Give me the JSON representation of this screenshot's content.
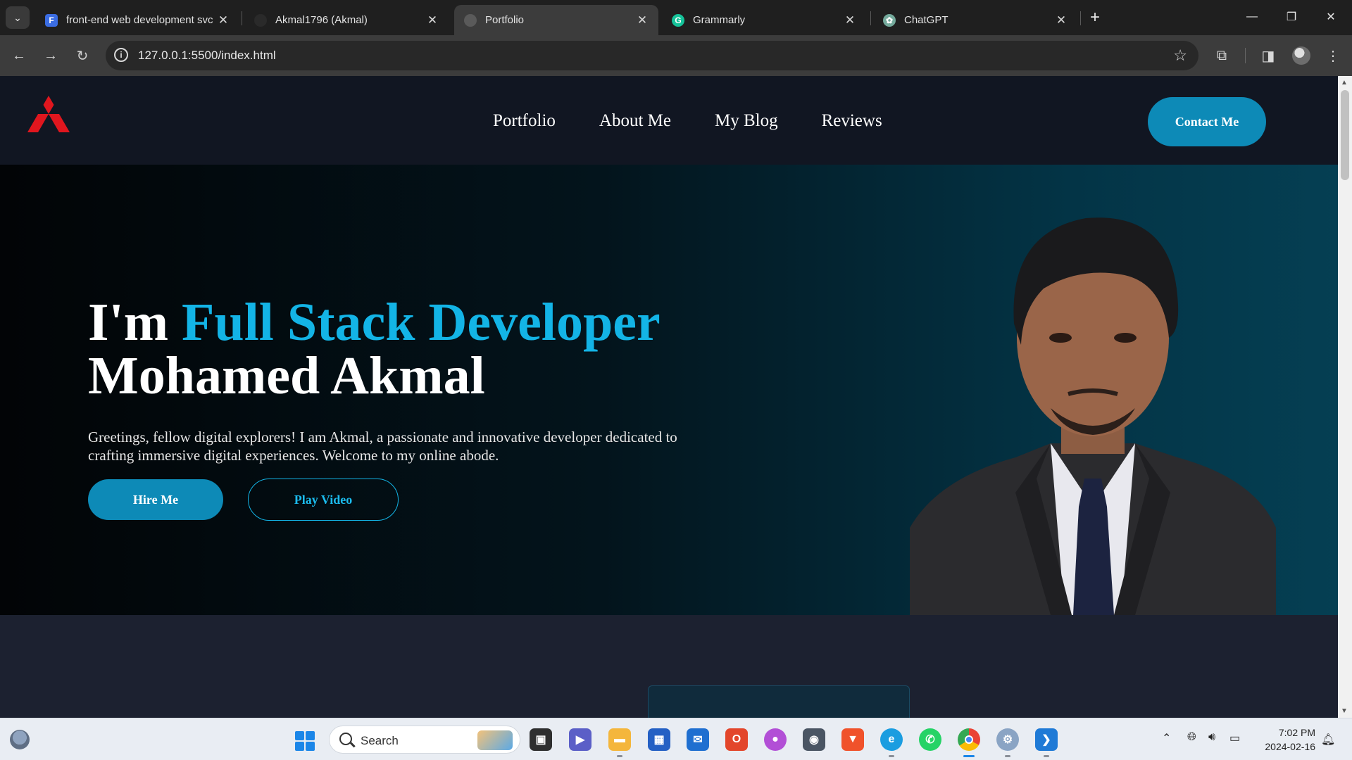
{
  "browser": {
    "tabs": [
      {
        "title": "front-end web development svc",
        "favicon": "forms-icon",
        "favicon_color": "#3b6de3",
        "active": false
      },
      {
        "title": "Akmal1796 (Akmal)",
        "favicon": "github-icon",
        "favicon_color": "#2a2a2a",
        "active": false
      },
      {
        "title": "Portfolio",
        "favicon": "globe-icon",
        "favicon_color": "#5a5a5a",
        "active": true
      },
      {
        "title": "Grammarly",
        "favicon": "grammarly-icon",
        "favicon_color": "#15c39a",
        "active": false
      },
      {
        "title": "ChatGPT",
        "favicon": "chatgpt-icon",
        "favicon_color": "#74aa9c",
        "active": false
      }
    ],
    "url": "127.0.0.1:5500/index.html"
  },
  "site": {
    "nav": [
      "Portfolio",
      "About Me",
      "My Blog",
      "Reviews"
    ],
    "contact_label": "Contact Me",
    "hero": {
      "title_prefix": "I'm ",
      "title_accent": "Full Stack Developer",
      "title_name": "Mohamed Akmal",
      "intro": "Greetings, fellow digital explorers! I am Akmal, a passionate and innovative developer dedicated to crafting immersive digital experiences. Welcome to my online abode.",
      "hire_label": "Hire Me",
      "video_label": "Play Video"
    },
    "colors": {
      "accent": "#13b4e6",
      "button": "#0d8ab7",
      "logo": "#e0161e",
      "header_bg": "#111622"
    }
  },
  "taskbar": {
    "search_label": "Search",
    "time": "7:02 PM",
    "date": "2024-02-16",
    "apps": [
      "task-view-icon",
      "teams-icon",
      "file-explorer-icon",
      "store-icon",
      "mail-icon",
      "office-icon",
      "paint-icon",
      "camera-icon",
      "brave-icon",
      "edge-icon",
      "whatsapp-icon",
      "chrome-icon",
      "settings-icon",
      "vscode-icon"
    ]
  }
}
